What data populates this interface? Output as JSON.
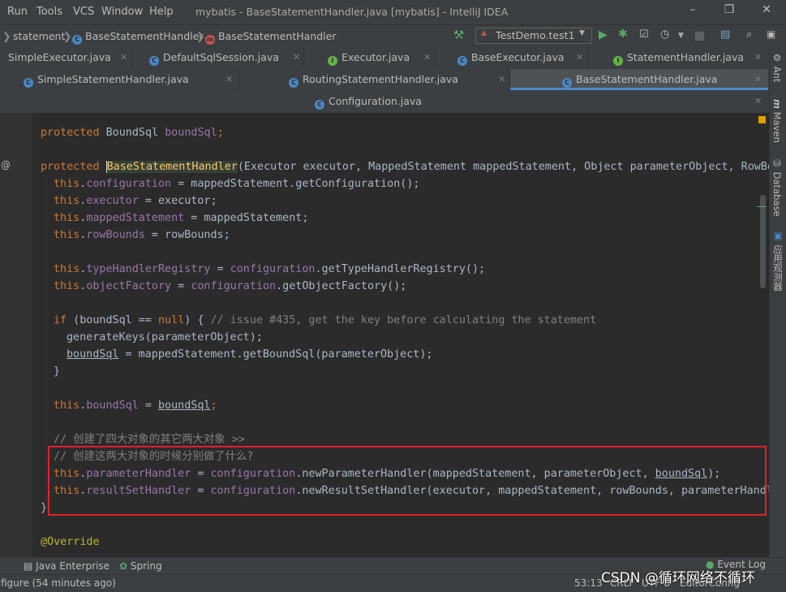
{
  "menu": [
    "Run",
    "Tools",
    "VCS",
    "Window",
    "Help"
  ],
  "window_title": "mybatis - BaseStatementHandler.java [mybatis] - IntelliJ IDEA",
  "breadcrumb": [
    "statement",
    "BaseStatementHandler",
    "BaseStatementHandler"
  ],
  "run_config": "TestDemo.test1",
  "tabs_row1": [
    "SimpleExecutor.java",
    "DefaultSqlSession.java",
    "Executor.java",
    "BaseExecutor.java",
    "StatementHandler.java"
  ],
  "tabs_row2": [
    "SimpleStatementHandler.java",
    "RoutingStatementHandler.java",
    "BaseStatementHandler.java"
  ],
  "tabs_row3": [
    "Configuration.java"
  ],
  "right_tools": [
    "Ant",
    "Maven",
    "Database",
    "应用观测器"
  ],
  "code": {
    "l1_kw": "protected",
    "l1_type": " BoundSql ",
    "l1_field": "boundSql",
    "l1_end": ";",
    "l2_kw": "protected",
    "l2_name": "BaseStatementHandler",
    "l2_rest": "(Executor executor, MappedStatement mappedStatement, Object parameterObject, RowBo",
    "this": "this",
    "f_configuration": "configuration",
    "l3_rest": " = mappedStatement.getConfiguration();",
    "f_executor": "executor",
    "l4_rest": " = executor;",
    "f_mappedStatement": "mappedStatement",
    "l5_rest": " = mappedStatement;",
    "f_rowBounds": "rowBounds",
    "l6_rest": " = rowBounds;",
    "f_typeHandlerRegistry": "typeHandlerRegistry",
    "eq": " = ",
    "m_getTypeHandlerRegistry": ".getTypeHandlerRegistry();",
    "f_objectFactory": "objectFactory",
    "m_getObjectFactory": ".getObjectFactory();",
    "if_kw": "if",
    "if_mid": " (boundSql == ",
    "null": "null",
    "if_end": ") { ",
    "if_comment": "// issue #435, get the key before calculating the statement",
    "gen_keys": "generateKeys(parameterObject);",
    "bs_var": "boundSql",
    "bs_rest": " = mappedStatement.getBoundSql(parameterObject);",
    "close_brace": "}",
    "f_boundSql": "boundSql",
    "semi": ";",
    "comment1": "// 创建了四大对象的其它两大对象 >>",
    "comment2": "// 创建这两大对象的时候分别做了什么?",
    "f_parameterHandler": "parameterHandler",
    "m_newParameterHandler": ".newParameterHandler(mappedStatement, parameterObject, ",
    "ph_end": ");",
    "f_resultSetHandler": "resultSetHandler",
    "m_newResultSetHandler": ".newResultSetHandler(executor, mappedStatement, rowBounds, parameterHandl",
    "override": "@Override"
  },
  "bottom_tools": [
    "Java Enterprise",
    "Spring",
    "Event Log"
  ],
  "status": {
    "left": "figure (54 minutes ago)",
    "position": "53:13",
    "line_sep": "CRLF",
    "encoding": "UTF-8",
    "config": "EditorConfig"
  },
  "watermark": "CSDN @循环网络不循环"
}
